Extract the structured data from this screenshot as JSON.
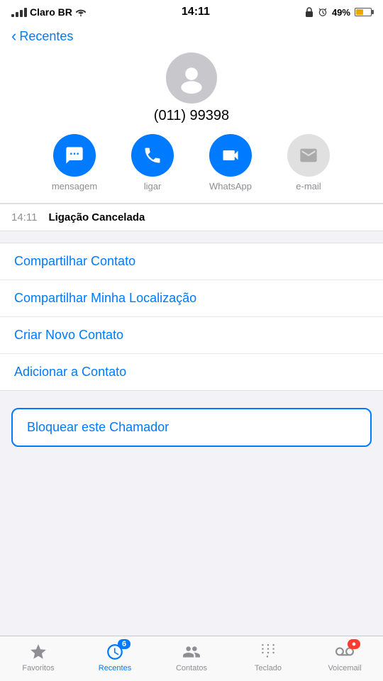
{
  "statusBar": {
    "carrier": "Claro BR",
    "time": "14:11",
    "batteryPercent": "49%"
  },
  "header": {
    "backLabel": "Recentes",
    "phoneNumber": "(011) 99398"
  },
  "actions": [
    {
      "id": "message",
      "label": "mensagem",
      "enabled": true,
      "icon": "chat"
    },
    {
      "id": "call",
      "label": "ligar",
      "enabled": true,
      "icon": "phone"
    },
    {
      "id": "whatsapp",
      "label": "WhatsApp",
      "enabled": true,
      "icon": "video"
    },
    {
      "id": "email",
      "label": "e-mail",
      "enabled": false,
      "icon": "mail"
    }
  ],
  "callInfo": {
    "time": "14:11",
    "status": "Ligação Cancelada"
  },
  "listItems": [
    "Compartilhar Contato",
    "Compartilhar Minha Localização",
    "Criar Novo Contato",
    "Adicionar a Contato"
  ],
  "blockLabel": "Bloquear este Chamador",
  "tabBar": {
    "tabs": [
      {
        "id": "favorites",
        "label": "Favoritos",
        "active": false,
        "badge": null
      },
      {
        "id": "recents",
        "label": "Recentes",
        "active": true,
        "badge": "6"
      },
      {
        "id": "contacts",
        "label": "Contatos",
        "active": false,
        "badge": null
      },
      {
        "id": "keypad",
        "label": "Teclado",
        "active": false,
        "badge": null
      },
      {
        "id": "voicemail",
        "label": "Voicemail",
        "active": false,
        "badge": "red"
      }
    ]
  }
}
